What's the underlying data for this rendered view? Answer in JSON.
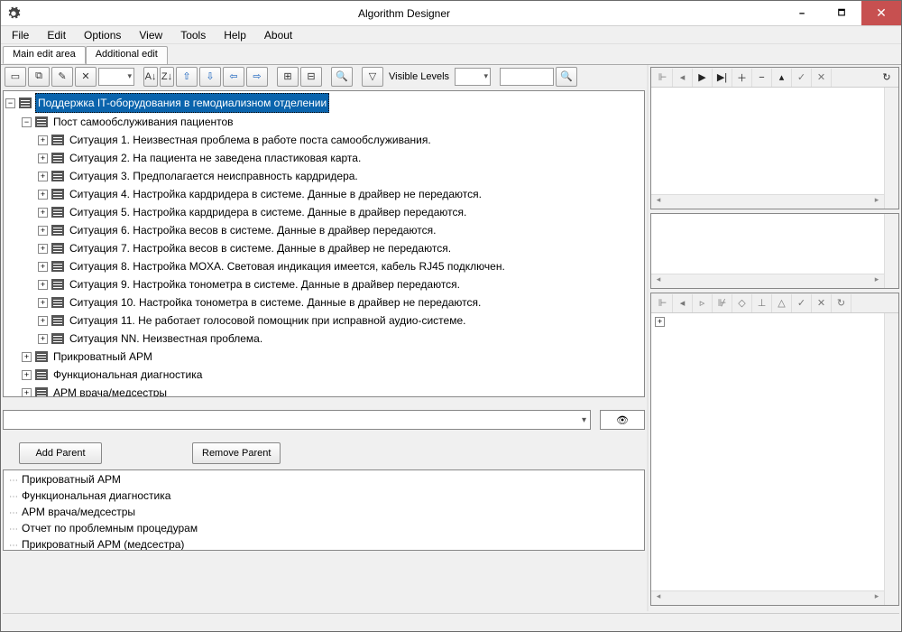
{
  "window": {
    "title": "Algorithm Designer"
  },
  "menu": [
    "File",
    "Edit",
    "Options",
    "View",
    "Tools",
    "Help",
    "About"
  ],
  "tabs": [
    "Main edit area",
    "Additional edit"
  ],
  "toolbar": {
    "visible_levels_label": "Visible Levels"
  },
  "tree": {
    "root": "Поддержка IT-оборудования в гемодиализном отделении",
    "section1": "Пост самообслуживания пациентов",
    "situations": [
      "Ситуация 1. Неизвестная проблема в работе поста самообслуживания.",
      "Ситуация 2. На пациента не заведена пластиковая карта.",
      "Ситуация 3. Предполагается неисправность кардридера.",
      "Ситуация 4. Настройка кардридера в системе. Данные в драйвер не передаются.",
      "Ситуация 5. Настройка кардридера в системе. Данные в драйвер передаются.",
      "Ситуация 6. Настройка весов в системе. Данные в драйвер передаются.",
      "Ситуация 7. Настройка весов в системе. Данные в драйвер не передаются.",
      "Ситуация 8. Настройка MOXA. Световая индикация имеется, кабель RJ45 подключен.",
      "Ситуация 9. Настройка тонометра в системе. Данные в драйвер передаются.",
      "Ситуация 10. Настройка тонометра в системе. Данные в драйвер не передаются.",
      "Ситуация 11. Не работает голосовой помощник при исправной аудио-системе.",
      "Ситуация NN. Неизвестная проблема."
    ],
    "others": [
      "Прикроватный АРМ",
      "Функциональная диагностика",
      "АРМ врача/медсестры"
    ]
  },
  "buttons": {
    "add_parent": "Add Parent",
    "remove_parent": "Remove Parent"
  },
  "bottomlist": [
    "Прикроватный АРМ",
    "Функциональная диагностика",
    "АРМ врача/медсестры",
    "Отчет по проблемным процедурам",
    "Прикроватный АРМ (медсестра)"
  ]
}
